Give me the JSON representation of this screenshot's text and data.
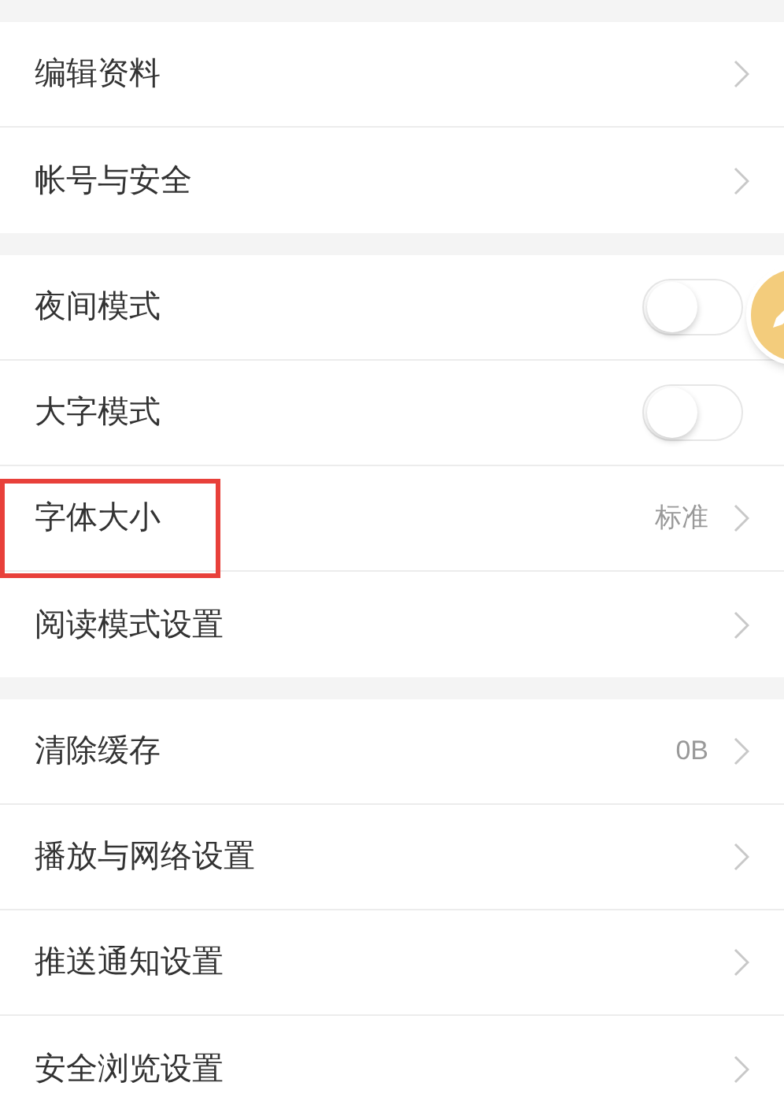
{
  "groups": [
    {
      "items": [
        {
          "kind": "nav",
          "label": "编辑资料",
          "highlighted": false
        },
        {
          "kind": "nav",
          "label": "帐号与安全",
          "highlighted": false
        }
      ]
    },
    {
      "items": [
        {
          "kind": "toggle",
          "label": "夜间模式",
          "on": false,
          "highlighted": false
        },
        {
          "kind": "toggle",
          "label": "大字模式",
          "on": false,
          "highlighted": false
        },
        {
          "kind": "value",
          "label": "字体大小",
          "value": "标准",
          "highlighted": true
        },
        {
          "kind": "nav",
          "label": "阅读模式设置",
          "highlighted": false
        }
      ]
    },
    {
      "items": [
        {
          "kind": "value",
          "label": "清除缓存",
          "value": "0B",
          "highlighted": false
        },
        {
          "kind": "nav",
          "label": "播放与网络设置",
          "highlighted": false
        },
        {
          "kind": "nav",
          "label": "推送通知设置",
          "highlighted": false
        },
        {
          "kind": "nav",
          "label": "安全浏览设置",
          "highlighted": false
        }
      ]
    }
  ]
}
